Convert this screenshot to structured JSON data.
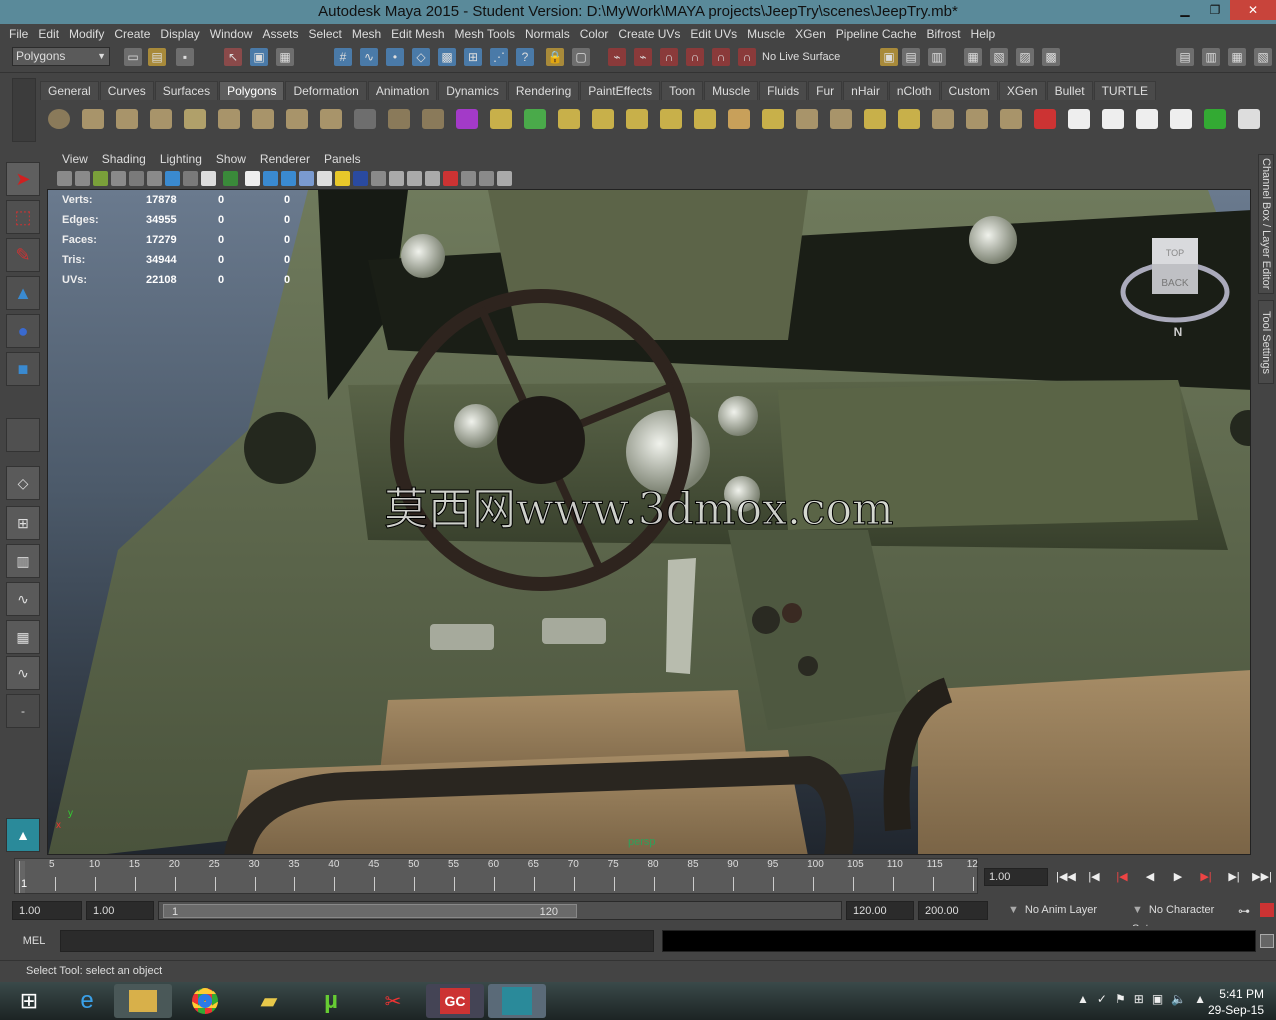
{
  "window": {
    "title": "Autodesk Maya 2015 - Student Version: D:\\MyWork\\MAYA projects\\JeepTry\\scenes\\JeepTry.mb*"
  },
  "menu": [
    "File",
    "Edit",
    "Modify",
    "Create",
    "Display",
    "Window",
    "Assets",
    "Select",
    "Mesh",
    "Edit Mesh",
    "Mesh Tools",
    "Normals",
    "Color",
    "Create UVs",
    "Edit UVs",
    "Muscle",
    "XGen",
    "Pipeline Cache",
    "Bifrost",
    "Help"
  ],
  "status_line": {
    "mode": "Polygons",
    "live_surface": "No Live Surface"
  },
  "shelf": {
    "tabs": [
      "General",
      "Curves",
      "Surfaces",
      "Polygons",
      "Deformation",
      "Animation",
      "Dynamics",
      "Rendering",
      "PaintEffects",
      "Toon",
      "Muscle",
      "Fluids",
      "Fur",
      "nHair",
      "nCloth",
      "Custom",
      "XGen",
      "Bullet",
      "TURTLE"
    ],
    "active_tab": "Polygons"
  },
  "panel": {
    "menu": [
      "View",
      "Shading",
      "Lighting",
      "Show",
      "Renderer",
      "Panels"
    ],
    "hud": [
      {
        "label": "Verts:",
        "a": "17878",
        "b": "0",
        "c": "0"
      },
      {
        "label": "Edges:",
        "a": "34955",
        "b": "0",
        "c": "0"
      },
      {
        "label": "Faces:",
        "a": "17279",
        "b": "0",
        "c": "0"
      },
      {
        "label": "Tris:",
        "a": "34944",
        "b": "0",
        "c": "0"
      },
      {
        "label": "UVs:",
        "a": "22108",
        "b": "0",
        "c": "0"
      }
    ],
    "camera": "persp",
    "watermark": "莫西网www.3dmox.com",
    "viewcube": {
      "top": "TOP",
      "front": "BACK",
      "compass": "N"
    },
    "axis": {
      "x": "x",
      "y": "y"
    }
  },
  "side_tabs": [
    "Channel Box / Layer Editor",
    "Tool Settings"
  ],
  "timeline": {
    "ticks": [
      "5",
      "10",
      "15",
      "20",
      "25",
      "30",
      "35",
      "40",
      "45",
      "50",
      "55",
      "60",
      "65",
      "70",
      "75",
      "80",
      "85",
      "90",
      "95",
      "100",
      "105",
      "110",
      "115",
      "12"
    ],
    "frame_marker": "1",
    "current_time": "1.00"
  },
  "range": {
    "start": "1.00",
    "anim_start": "1.00",
    "slider_start": "1",
    "slider_end": "120",
    "anim_end": "120.00",
    "end": "200.00",
    "anim_layer": "No Anim Layer",
    "char_set": "No Character Set"
  },
  "command": {
    "label": "MEL"
  },
  "help_line": "Select Tool: select an object",
  "taskbar": {
    "time": "5:41 PM",
    "date": "29-Sep-15"
  }
}
